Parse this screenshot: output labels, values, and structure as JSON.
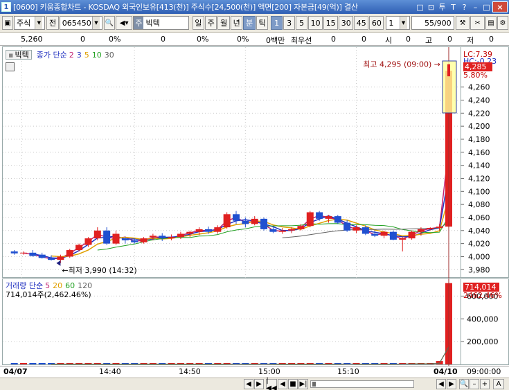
{
  "title": {
    "app_number": "1",
    "text": "[0600] 키움종합차트 - KOSDAQ 외국인보유[413(천)] 주식수[24,500(천)] 액면[200] 자본금[49(억)] 결산",
    "buttons": [
      "□",
      "⊡",
      "투",
      "T",
      "?",
      "–",
      "□",
      "×"
    ]
  },
  "toolbar": {
    "market": "주식",
    "jeon_label": "전",
    "code": "065450",
    "name_prefix": "주",
    "stock_name": "빅텍",
    "periods": [
      "일",
      "주",
      "월",
      "년",
      "분",
      "틱"
    ],
    "period_active": "분",
    "intervals": [
      "1",
      "3",
      "5",
      "10",
      "15",
      "30",
      "45",
      "60"
    ],
    "interval_active": "1",
    "multiplier": "1",
    "count": "55/900"
  },
  "quote_strip": {
    "price": "5,260",
    "c1": "0",
    "c2": "0%",
    "c3": "0",
    "c4": "0%",
    "c5": "0%",
    "c6": "0백만",
    "broker_label": "최우선",
    "c7": "0",
    "c8": "0",
    "si_label": "시",
    "si": "0",
    "go_label": "고",
    "go": "0",
    "jeo_label": "저",
    "jeo": "0"
  },
  "price_chart": {
    "stock_label": "빅텍",
    "legend_title": "종가 단순",
    "ma_periods": [
      "2",
      "3",
      "5",
      "10",
      "30"
    ],
    "ma_colors": [
      "#c02070",
      "#2030c0",
      "#e0a000",
      "#20a020",
      "#606060"
    ],
    "high_annotation": "최고 4,295 (09:00)",
    "low_annotation": "최저 3,990 (14:32)",
    "lc_label": "LC:7.39",
    "hc_label": "HC:-0.23",
    "current_price": "4,285",
    "current_pct": "5.80%",
    "y_ticks": [
      "4,260",
      "4,240",
      "4,220",
      "4,200",
      "4,180",
      "4,160",
      "4,140",
      "4,120",
      "4,100",
      "4,080",
      "4,060",
      "4,040",
      "4,020",
      "4,000",
      "3,980"
    ]
  },
  "volume_chart": {
    "legend_title": "거래량 단순",
    "ma_periods": [
      "5",
      "20",
      "60",
      "120"
    ],
    "ma_colors": [
      "#c02070",
      "#e0a000",
      "#20a020",
      "#606060"
    ],
    "summary": "714,014주(2,462.46%)",
    "current_volume": "714,014",
    "current_pct": "2462.46%",
    "y_ticks": [
      "600,000",
      "400,000",
      "200,000"
    ]
  },
  "time_axis": {
    "labels": [
      "04/07",
      "14:40",
      "14:50",
      "15:00",
      "15:10",
      "04/10"
    ],
    "right_time": "09:00:00"
  },
  "chart_data": {
    "type": "candlestick",
    "price_ylim": [
      3975,
      4300
    ],
    "candles": [
      {
        "o": 4008,
        "h": 4010,
        "l": 4003,
        "c": 4005
      },
      {
        "o": 4005,
        "h": 4008,
        "l": 4003,
        "c": 4006
      },
      {
        "o": 4006,
        "h": 4010,
        "l": 4000,
        "c": 4001
      },
      {
        "o": 4003,
        "h": 4006,
        "l": 3997,
        "c": 3998
      },
      {
        "o": 3998,
        "h": 4002,
        "l": 3994,
        "c": 3995
      },
      {
        "o": 3995,
        "h": 4003,
        "l": 3990,
        "c": 4000
      },
      {
        "o": 4000,
        "h": 4012,
        "l": 3998,
        "c": 4010
      },
      {
        "o": 4010,
        "h": 4020,
        "l": 4008,
        "c": 4018
      },
      {
        "o": 4018,
        "h": 4030,
        "l": 4015,
        "c": 4028
      },
      {
        "o": 4028,
        "h": 4045,
        "l": 4025,
        "c": 4040
      },
      {
        "o": 4040,
        "h": 4045,
        "l": 4018,
        "c": 4020
      },
      {
        "o": 4020,
        "h": 4040,
        "l": 4018,
        "c": 4035
      },
      {
        "o": 4028,
        "h": 4030,
        "l": 4020,
        "c": 4025
      },
      {
        "o": 4025,
        "h": 4028,
        "l": 4020,
        "c": 4022
      },
      {
        "o": 4022,
        "h": 4030,
        "l": 4020,
        "c": 4028
      },
      {
        "o": 4030,
        "h": 4035,
        "l": 4025,
        "c": 4032
      },
      {
        "o": 4032,
        "h": 4036,
        "l": 4024,
        "c": 4028
      },
      {
        "o": 4028,
        "h": 4034,
        "l": 4025,
        "c": 4030
      },
      {
        "o": 4030,
        "h": 4038,
        "l": 4027,
        "c": 4035
      },
      {
        "o": 4035,
        "h": 4040,
        "l": 4030,
        "c": 4038
      },
      {
        "o": 4038,
        "h": 4045,
        "l": 4033,
        "c": 4042
      },
      {
        "o": 4042,
        "h": 4046,
        "l": 4035,
        "c": 4038
      },
      {
        "o": 4038,
        "h": 4048,
        "l": 4035,
        "c": 4045
      },
      {
        "o": 4045,
        "h": 4068,
        "l": 4043,
        "c": 4065
      },
      {
        "o": 4065,
        "h": 4070,
        "l": 4050,
        "c": 4055
      },
      {
        "o": 4055,
        "h": 4060,
        "l": 4045,
        "c": 4050
      },
      {
        "o": 4050,
        "h": 4062,
        "l": 4048,
        "c": 4058
      },
      {
        "o": 4058,
        "h": 4060,
        "l": 4040,
        "c": 4042
      },
      {
        "o": 4042,
        "h": 4045,
        "l": 4036,
        "c": 4038
      },
      {
        "o": 4038,
        "h": 4044,
        "l": 4035,
        "c": 4040
      },
      {
        "o": 4040,
        "h": 4045,
        "l": 4036,
        "c": 4042
      },
      {
        "o": 4042,
        "h": 4050,
        "l": 4040,
        "c": 4047
      },
      {
        "o": 4047,
        "h": 4070,
        "l": 4045,
        "c": 4068
      },
      {
        "o": 4068,
        "h": 4070,
        "l": 4055,
        "c": 4058
      },
      {
        "o": 4058,
        "h": 4064,
        "l": 4052,
        "c": 4062
      },
      {
        "o": 4062,
        "h": 4064,
        "l": 4050,
        "c": 4052
      },
      {
        "o": 4052,
        "h": 4056,
        "l": 4038,
        "c": 4040
      },
      {
        "o": 4040,
        "h": 4048,
        "l": 4036,
        "c": 4045
      },
      {
        "o": 4045,
        "h": 4048,
        "l": 4033,
        "c": 4035
      },
      {
        "o": 4035,
        "h": 4040,
        "l": 4030,
        "c": 4032
      },
      {
        "o": 4032,
        "h": 4040,
        "l": 4028,
        "c": 4038
      },
      {
        "o": 4038,
        "h": 4040,
        "l": 4025,
        "c": 4026
      },
      {
        "o": 4026,
        "h": 4030,
        "l": 4008,
        "c": 4028
      },
      {
        "o": 4028,
        "h": 4040,
        "l": 4026,
        "c": 4038
      },
      {
        "o": 4038,
        "h": 4045,
        "l": 4032,
        "c": 4042
      },
      {
        "o": 4042,
        "h": 4045,
        "l": 4040,
        "c": 4044
      },
      {
        "o": 4044,
        "h": 4050,
        "l": 4040,
        "c": 4046
      },
      {
        "o": 4046,
        "h": 4295,
        "l": 4044,
        "c": 4285
      }
    ],
    "volumes": [
      1800,
      1200,
      1500,
      900,
      1100,
      2500,
      1400,
      1700,
      3200,
      2000,
      1800,
      1600,
      1300,
      1500,
      1700,
      1400,
      1600,
      1900,
      2100,
      1800,
      2400,
      2000,
      1700,
      5000,
      2600,
      1800,
      2200,
      2800,
      1500,
      1600,
      1400,
      1700,
      4200,
      2300,
      2000,
      2600,
      3000,
      2100,
      1900,
      2200,
      2500,
      4000,
      3800,
      6000,
      5500,
      8000,
      30000,
      714014
    ],
    "volume_ylim": [
      0,
      700000
    ]
  },
  "bottom_bar": {
    "buttons": [
      "◀",
      "▶",
      "|◀◀",
      "◀",
      "■",
      "▶|",
      "▶▶"
    ],
    "tools": [
      "◀",
      "▶",
      "🔍",
      "–",
      "+",
      "A"
    ]
  }
}
